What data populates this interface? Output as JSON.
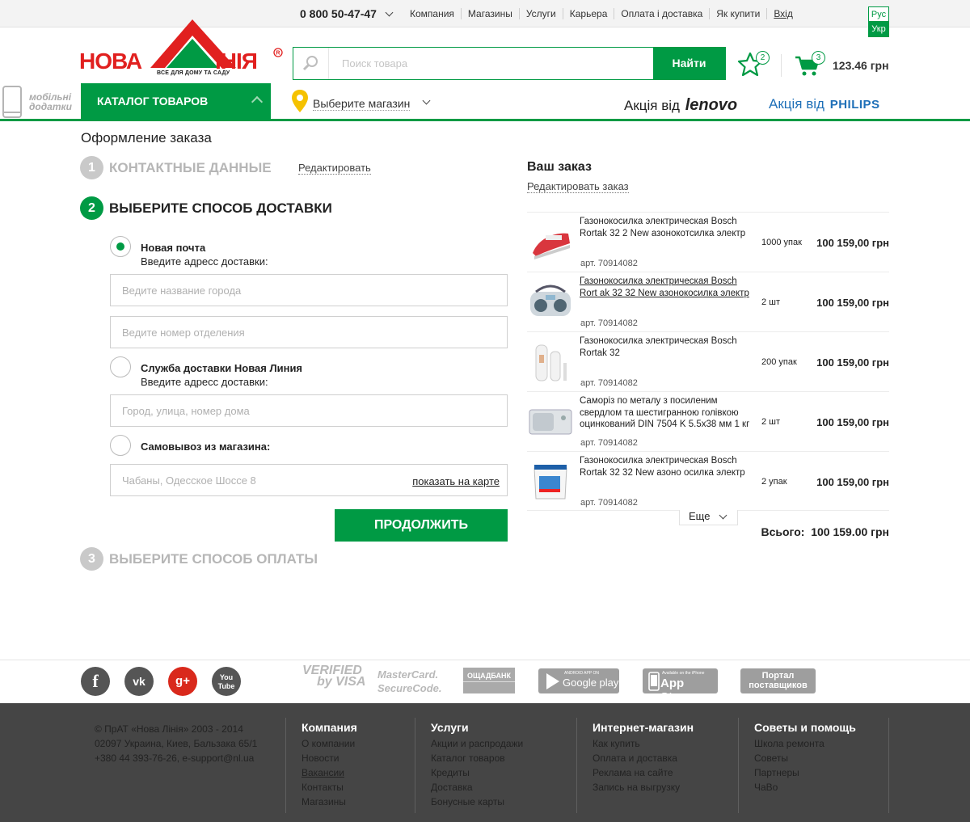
{
  "topbar": {
    "phone": "0 800 50-47-47",
    "links": [
      "Компания",
      "Магазины",
      "Услуги",
      "Карьера",
      "Оплата і доставка",
      "Як купити",
      "Вхід"
    ],
    "lang_ru": "Рус",
    "lang_uk": "Укр"
  },
  "logo": {
    "word1": "НОВА",
    "word2": "ІНІЯ",
    "tagline": "ВСЕ ДЛЯ ДОМУ ТА САДУ"
  },
  "search": {
    "placeholder": "Поиск товара",
    "button": "Найти"
  },
  "favorites": {
    "count": "2"
  },
  "cart": {
    "count": "3",
    "total": "123.46 грн"
  },
  "mobile": {
    "line1": "мобільні",
    "line2": "додатки"
  },
  "catalog": {
    "label": "КАТАЛОГ ТОВАРОВ"
  },
  "store": {
    "label": "Выберите магазин"
  },
  "promos": {
    "lenovo_prefix": "Акція від",
    "lenovo": "lenovo",
    "philips_prefix": "Акція від",
    "philips": "PHILIPS"
  },
  "checkout": {
    "title": "Оформление заказа",
    "step1": {
      "num": "1",
      "title": "КОНТАКТНЫЕ ДАННЫЕ",
      "edit": "Редактировать"
    },
    "step2": {
      "num": "2",
      "title": "ВЫБЕРИТЕ СПОСОБ ДОСТАВКИ"
    },
    "step3": {
      "num": "3",
      "title": "ВЫБЕРИТЕ СПОСОБ ОПЛАТЫ"
    },
    "option1": {
      "label": "Новая почта",
      "sub": "Введите адресс доставки:",
      "city_placeholder": "Ведите название города",
      "branch_placeholder": "Ведите номер отделения"
    },
    "option2": {
      "label": "Служба доставки Новая Линия",
      "sub": "Введите адресс доставки:",
      "address_placeholder": "Город, улица, номер дома"
    },
    "option3": {
      "label": "Самовывоз из магазина:",
      "store_value": "Чабаны, Одесское Шоссе 8",
      "map_link": "показать на карте"
    },
    "continue": "ПРОДОЛЖИТЬ"
  },
  "order": {
    "title": "Ваш заказ",
    "edit": "Редактировать заказ",
    "items": [
      {
        "name": "Газонокосилка электрическая Bosch Rortak 32 2 New азонокотсилка электр",
        "art": "арт. 70914082",
        "qty": "1000 упак",
        "price": "100 159,00 грн"
      },
      {
        "name": "Газонокосилка электрическая Bosch Rort ak 32 32 New азонокосилка электр",
        "art": "арт. 70914082",
        "qty": "2 шт",
        "price": "100 159,00 грн"
      },
      {
        "name": "Газонокосилка электрическая Bosch Rortak 32",
        "art": "арт. 70914082",
        "qty": "200 упак",
        "price": "100 159,00 грн"
      },
      {
        "name": "Саморіз по металу з посиленим свердлом та шестигранною голівкою оцинкований DIN 7504 K 5.5x38 мм 1 кг",
        "art": "арт. 70914082",
        "qty": "2 шт",
        "price": "100 159,00 грн"
      },
      {
        "name": "Газонокосилка электрическая Bosch Rortak 32 32 New азоно осилка электр",
        "art": "арт. 70914082",
        "qty": "2 упак",
        "price": "100 159,00 грн"
      }
    ],
    "more": "Еще",
    "total_label": "Всього:",
    "total_value": "100 159.00 грн"
  },
  "footer_strip": {
    "social": [
      "f",
      "vk",
      "g+",
      "You Tube"
    ],
    "verified_1": "VERIFIED",
    "verified_2": "by VISA",
    "mastercard_1": "MasterCard.",
    "mastercard_2": "SecureCode.",
    "oschadbank": "ОЩАДБАНК",
    "google_small": "ANDROID APP ON",
    "google_big": "Google play",
    "apple_small": "Available on the iPhone",
    "apple_big": "App Store",
    "portal_1": "Портал",
    "portal_2": "поставщиков"
  },
  "footer": {
    "about": [
      "© ПрАТ «Нова Лінія» 2003 - 2014",
      "02097 Украина, Киев, Бальзака 65/1",
      "+380 44 393-76-26, e-support@nl.ua"
    ],
    "col1": {
      "title": "Компания",
      "links": [
        "О компании",
        "Новости",
        "Вакансии",
        "Контакты",
        "Магазины"
      ]
    },
    "col2": {
      "title": "Услуги",
      "links": [
        "Акции и распродажи",
        "Каталог товаров",
        "Кредиты",
        "Доставка",
        "Бонусные карты"
      ]
    },
    "col3": {
      "title": "Интернет-магазин",
      "links": [
        "Как купить",
        "Оплата и доставка",
        "Реклама на сайте",
        "Запись на выгрузку"
      ]
    },
    "col4": {
      "title": "Советы и помощь",
      "links": [
        "Школа ремонта",
        "Советы",
        "Партнеры",
        "ЧаВо"
      ]
    }
  },
  "colors": {
    "brand_green": "#009a44",
    "logo_red": "#e1201f",
    "footer_bg": "#454545"
  }
}
